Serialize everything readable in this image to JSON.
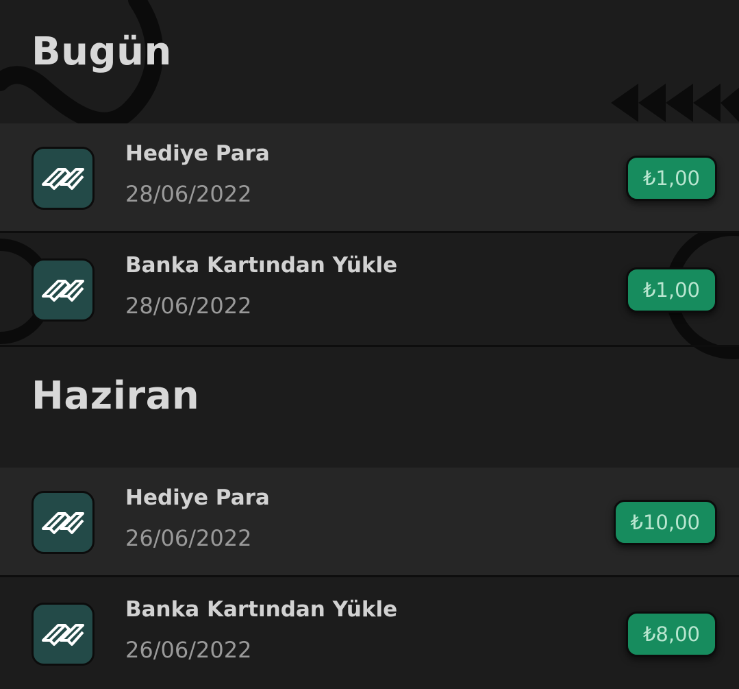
{
  "sections": [
    {
      "title": "Bugün",
      "rows": [
        {
          "title": "Hediye Para",
          "date": "28/06/2022",
          "amount": "₺1,00",
          "icon": "wallet-logo-icon"
        },
        {
          "title": "Banka Kartından Yükle",
          "date": "28/06/2022",
          "amount": "₺1,00",
          "icon": "wallet-logo-icon"
        }
      ]
    },
    {
      "title": "Haziran",
      "rows": [
        {
          "title": "Hediye Para",
          "date": "26/06/2022",
          "amount": "₺10,00",
          "icon": "wallet-logo-icon"
        },
        {
          "title": "Banka Kartından Yükle",
          "date": "26/06/2022",
          "amount": "₺8,00",
          "icon": "wallet-logo-icon"
        }
      ]
    }
  ],
  "colors": {
    "background": "#1c1c1c",
    "row_light": "#262626",
    "icon_bg": "#234a48",
    "amount_bg": "#178c5e",
    "amount_text": "#b9e6d0"
  }
}
